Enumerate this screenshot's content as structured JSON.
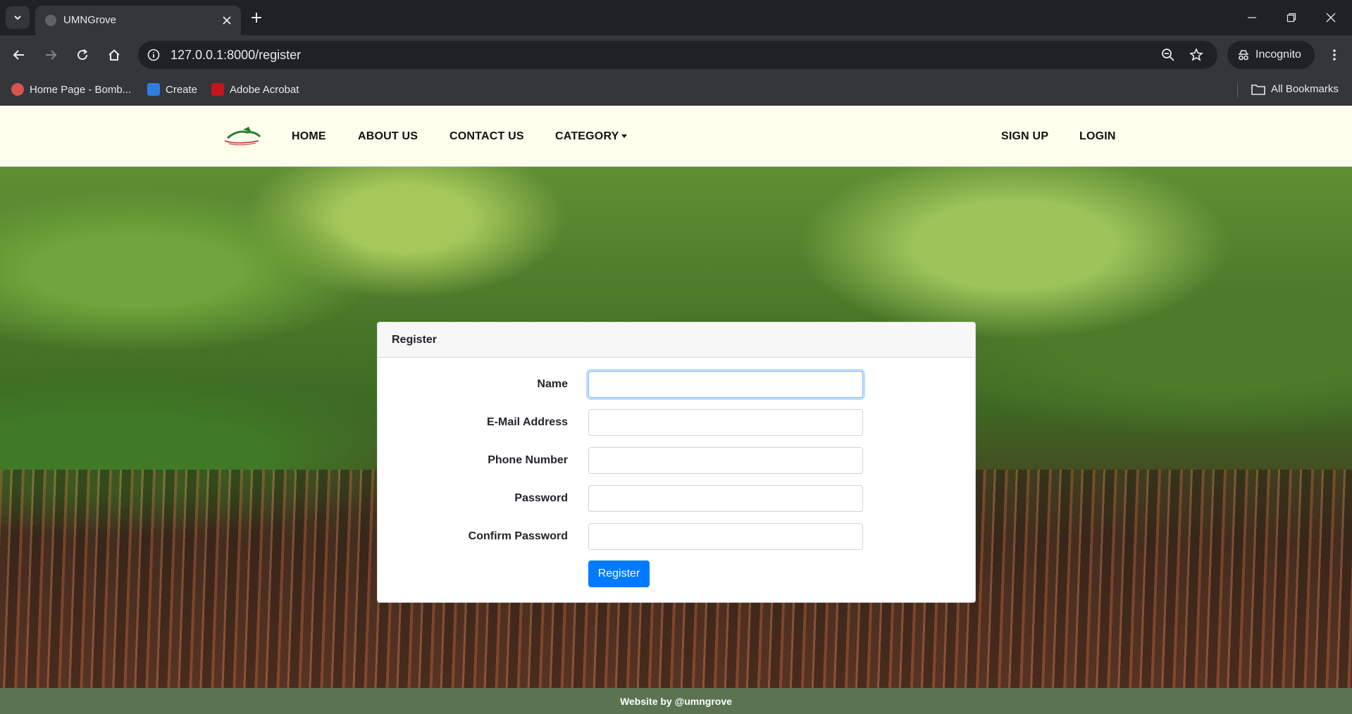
{
  "browser": {
    "tab_title": "UMNGrove",
    "url": "127.0.0.1:8000/register",
    "profile_label": "Incognito",
    "bookmarks": [
      {
        "label": "Home Page - Bomb...",
        "color": "#d9534f"
      },
      {
        "label": "Create",
        "color": "#2f7de1"
      },
      {
        "label": "Adobe Acrobat",
        "color": "#c4161c"
      }
    ],
    "all_bookmarks_label": "All Bookmarks"
  },
  "navbar": {
    "links": [
      "HOME",
      "ABOUT US",
      "CONTACT US",
      "CATEGORY"
    ],
    "right_links": [
      "SIGN UP",
      "LOGIN"
    ]
  },
  "form": {
    "title": "Register",
    "fields": [
      {
        "label": "Name",
        "value": ""
      },
      {
        "label": "E-Mail Address",
        "value": ""
      },
      {
        "label": "Phone Number",
        "value": ""
      },
      {
        "label": "Password",
        "value": ""
      },
      {
        "label": "Confirm Password",
        "value": ""
      }
    ],
    "submit_label": "Register"
  },
  "footer": {
    "text": "Website by @umngrove"
  },
  "colors": {
    "navbar_bg": "#fdfeec",
    "primary": "#007bff",
    "footer_bg": "#5c7352"
  }
}
